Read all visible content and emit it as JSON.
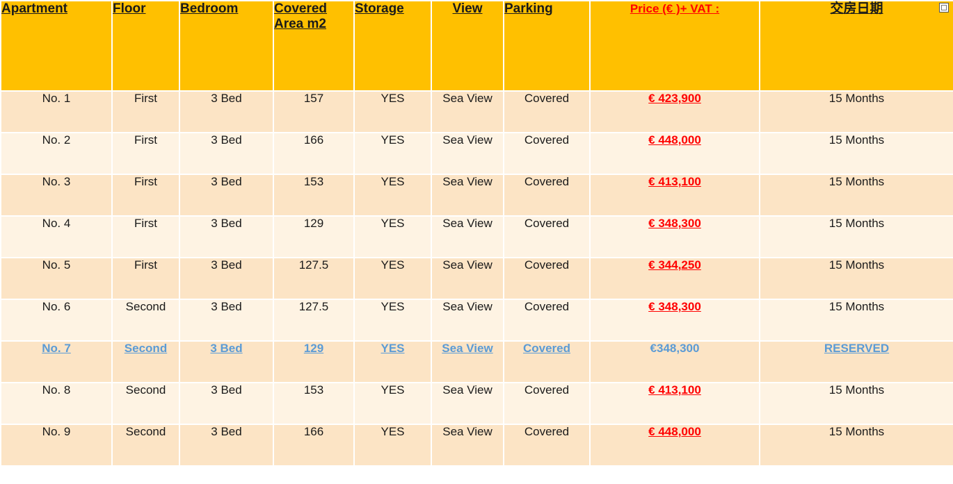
{
  "table": {
    "headers": {
      "apartment": "Apartment",
      "floor": "Floor",
      "bedroom": "Bedroom",
      "covered_area": "Covered Area m2",
      "storage": "Storage",
      "view": "View",
      "parking": "Parking",
      "price": "Price (€ )+ VAT :",
      "handover": "交房日期"
    },
    "rows": [
      {
        "apartment": "No. 1",
        "floor": "First",
        "bedroom": "3 Bed",
        "area": "157",
        "storage": "YES",
        "view": "Sea View",
        "parking": "Covered",
        "price": "€ 423,900",
        "handover": "15 Months"
      },
      {
        "apartment": "No. 2",
        "floor": "First",
        "bedroom": "3 Bed",
        "area": "166",
        "storage": "YES",
        "view": "Sea View",
        "parking": "Covered",
        "price": "€ 448,000",
        "handover": "15 Months"
      },
      {
        "apartment": "No. 3",
        "floor": "First",
        "bedroom": "3 Bed",
        "area": "153",
        "storage": "YES",
        "view": "Sea View",
        "parking": "Covered",
        "price": "€ 413,100",
        "handover": "15 Months"
      },
      {
        "apartment": "No. 4",
        "floor": "First",
        "bedroom": "3 Bed",
        "area": "129",
        "storage": "YES",
        "view": "Sea View",
        "parking": "Covered",
        "price": "€ 348,300",
        "handover": "15 Months"
      },
      {
        "apartment": "No. 5",
        "floor": "First",
        "bedroom": "3 Bed",
        "area": "127.5",
        "storage": "YES",
        "view": "Sea View",
        "parking": "Covered",
        "price": "€ 344,250",
        "handover": "15 Months"
      },
      {
        "apartment": "No. 6",
        "floor": "Second",
        "bedroom": "3 Bed",
        "area": "127.5",
        "storage": "YES",
        "view": "Sea View",
        "parking": "Covered",
        "price": "€ 348,300",
        "handover": "15 Months"
      },
      {
        "apartment": "No. 7",
        "floor": "Second",
        "bedroom": "3 Bed",
        "area": "129",
        "storage": "YES",
        "view": "Sea View",
        "parking": "Covered",
        "price": "€348,300",
        "handover": "RESERVED"
      },
      {
        "apartment": "No. 8",
        "floor": "Second",
        "bedroom": "3 Bed",
        "area": "153",
        "storage": "YES",
        "view": "Sea View",
        "parking": "Covered",
        "price": "€ 413,100",
        "handover": "15 Months"
      },
      {
        "apartment": "No. 9",
        "floor": "Second",
        "bedroom": "3 Bed",
        "area": "166",
        "storage": "YES",
        "view": "Sea View",
        "parking": "Covered",
        "price": "€ 448,000",
        "handover": "15 Months"
      }
    ]
  },
  "colors": {
    "header_bg": "#ffc000",
    "row_odd_bg": "#fce4c5",
    "row_even_bg": "#fef3e3",
    "price_red": "#ff0000",
    "reserved_blue": "#5b9bd5"
  },
  "icons": {
    "corner": "image-placeholder-icon"
  }
}
